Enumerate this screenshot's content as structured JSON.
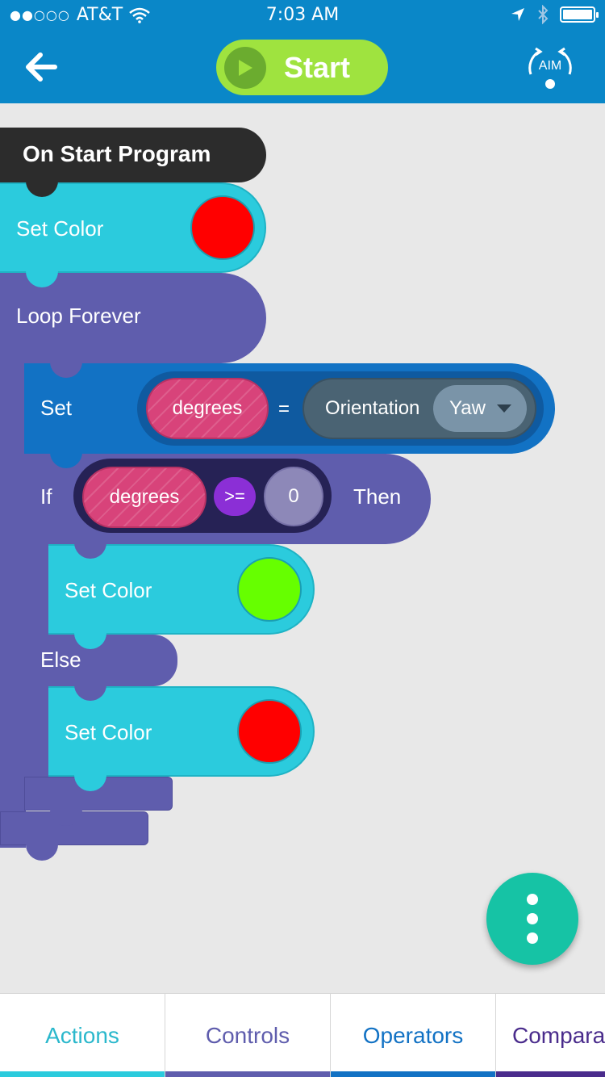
{
  "status_bar": {
    "signal": "●●○○○",
    "carrier": "AT&T",
    "time": "7:03 AM"
  },
  "header": {
    "start_label": "Start",
    "aim_label": "AIM"
  },
  "program": {
    "on_start": "On Start Program",
    "set_color_1": {
      "label": "Set Color",
      "color": "#ff0000"
    },
    "loop": "Loop Forever",
    "set": {
      "label": "Set",
      "variable": "degrees",
      "equals": "=",
      "sensor": "Orientation",
      "axis": "Yaw"
    },
    "if": {
      "label": "If",
      "variable": "degrees",
      "operator": ">=",
      "value": "0",
      "then": "Then"
    },
    "set_color_2": {
      "label": "Set Color",
      "color": "#66ff00"
    },
    "else": "Else",
    "set_color_3": {
      "label": "Set Color",
      "color": "#ff0000"
    }
  },
  "tabs": [
    {
      "label": "Actions",
      "color": "#2bcbdd"
    },
    {
      "label": "Controls",
      "color": "#5f5dad"
    },
    {
      "label": "Operators",
      "color": "#1272c4"
    },
    {
      "label": "Compara",
      "color": "#4a2c8c"
    }
  ],
  "icons": [
    "wifi-icon",
    "location-icon",
    "bluetooth-icon",
    "battery-icon",
    "back-arrow-icon",
    "play-icon",
    "aim-icon",
    "more-vertical-icon"
  ]
}
